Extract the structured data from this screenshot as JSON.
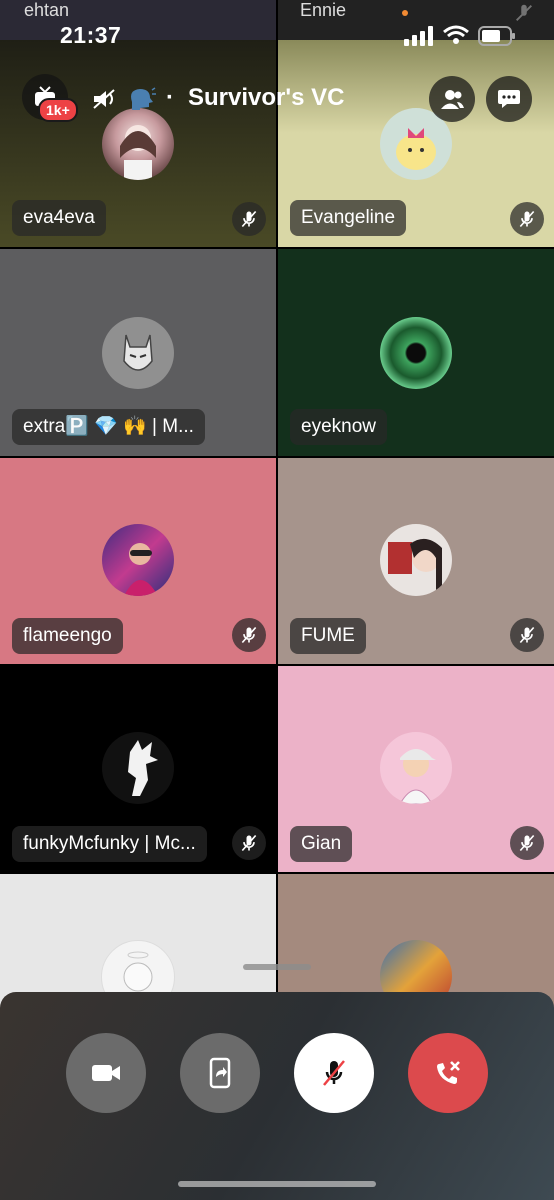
{
  "status_bar": {
    "time": "21:37",
    "signal_icon": "cellular-signal-icon",
    "wifi_icon": "wifi-icon",
    "battery_icon": "battery-icon"
  },
  "peek_row": {
    "left_name": "ehtan",
    "right_name": "Ennie"
  },
  "header": {
    "badge": "1k+",
    "title": "Survivor's VC",
    "separator": "·",
    "channel_icons": [
      "deafened-icon",
      "speaking-head-emoji"
    ]
  },
  "tiles": [
    {
      "name": "eva4eva",
      "muted": true,
      "bg": "#3b3a1e"
    },
    {
      "name": "Evangeline",
      "muted": true,
      "bg": "#d9d7a6"
    },
    {
      "name": "extra🅿️ 💎 🙌 | M...",
      "muted": false,
      "bg": "#5d5d5f"
    },
    {
      "name": "eyeknow",
      "muted": false,
      "bg": "#13301c"
    },
    {
      "name": "flameengo",
      "muted": true,
      "bg": "#d77883"
    },
    {
      "name": "FUME",
      "muted": true,
      "bg": "#a6948c"
    },
    {
      "name": "funkyMcfunky | Mc...",
      "muted": true,
      "bg": "#000000"
    },
    {
      "name": "Gian",
      "muted": true,
      "bg": "#ecb2c8"
    },
    {
      "name": "",
      "muted": false,
      "bg": "#e7e7e7"
    },
    {
      "name": "",
      "muted": false,
      "bg": "#a48a7e"
    }
  ],
  "controls": {
    "camera": "camera-icon",
    "screen_share": "screen-share-icon",
    "mute": "mic-muted-icon",
    "disconnect": "disconnect-call-icon"
  },
  "colors": {
    "danger": "#ed4245",
    "control_gray": "#6b6b6b"
  }
}
